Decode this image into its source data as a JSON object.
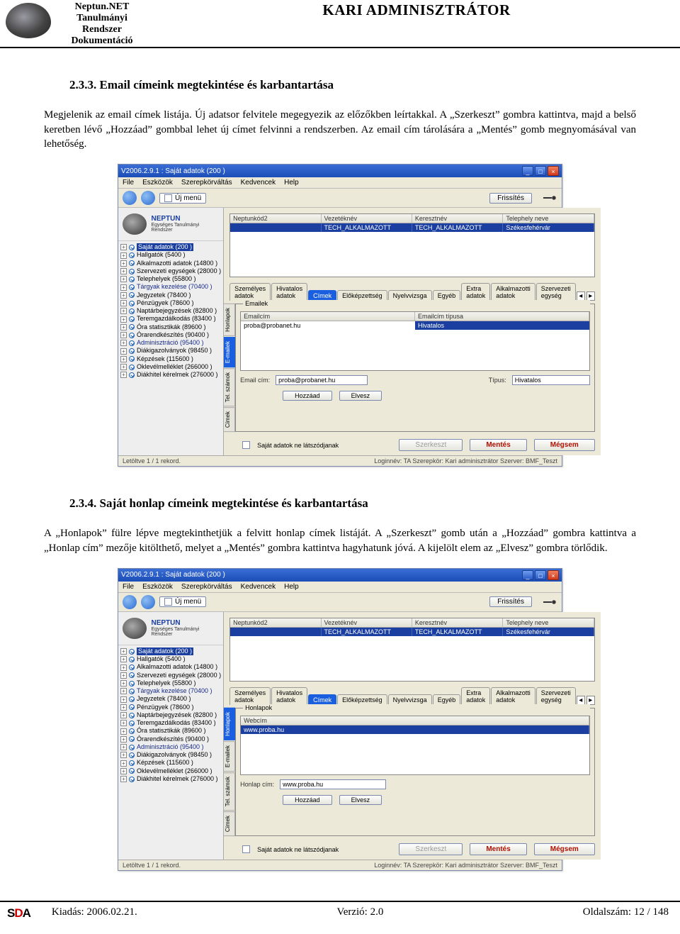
{
  "doc_header": {
    "line1": "Neptun.NET",
    "line2": "Tanulmányi",
    "line3": "Rendszer",
    "line4": "Dokumentáció",
    "role_title": "KARI ADMINISZTRÁTOR"
  },
  "section_233": {
    "heading": "2.3.3. Email címeink megtekintése és karbantartása",
    "para": "Megjelenik az email címek listája. Új adatsor felvitele megegyezik az előzőkben leírtakkal. A „Szerkeszt” gombra kattintva, majd a belső keretben lévő „Hozzáad” gombbal lehet új címet felvinni a rendszerben. Az email cím tárolására a „Mentés” gomb megnyomásával van lehetőség."
  },
  "section_234": {
    "heading": "2.3.4. Saját honlap címeink megtekintése és karbantartása",
    "para": "A „Honlapok” fülre lépve megtekinthetjük a felvitt honlap címek listáját. A „Szerkeszt” gomb után a „Hozzáad” gombra kattintva a „Honlap cím” mezője kitölthető, melyet a „Mentés” gombra kattintva hagyhatunk jóvá. A kijelölt elem az „Elvesz” gombra törlődik."
  },
  "app_common": {
    "title": "V2006.2.9.1 : Saját adatok (200  )",
    "menus": [
      "File",
      "Eszközök",
      "Szerepkörváltás",
      "Kedvencek",
      "Help"
    ],
    "newmenu": "Új menü",
    "refresh": "Frissítés",
    "brand": "NEPTUN",
    "brand_sub": "Egységes Tanulmányi Rendszer",
    "tree": [
      {
        "t": "Saját adatok (200  )",
        "sel": true,
        "top": true
      },
      {
        "t": "Hallgatók (5400  )"
      },
      {
        "t": "Alkalmazotti adatok (14800  )"
      },
      {
        "t": "Szervezeti egységek (28000  )"
      },
      {
        "t": "Telephelyek (55800  )"
      },
      {
        "t": "Tárgyak kezelése (70400  )",
        "blue": true
      },
      {
        "t": "Jegyzetek (78400  )"
      },
      {
        "t": "Pénzügyek (78600  )"
      },
      {
        "t": "Naptárbejegyzések (82800  )"
      },
      {
        "t": "Teremgazdálkodás (83400  )"
      },
      {
        "t": "Óra statisztikák (89600  )"
      },
      {
        "t": "Órarendkészítés (90400  )"
      },
      {
        "t": "Adminisztráció (95400  )",
        "blue": true
      },
      {
        "t": "Diákigazolványok (98450  )"
      },
      {
        "t": "Képzések (115600  )"
      },
      {
        "t": "Oklevélmelléklet (266000  )"
      },
      {
        "t": "Diákhitel kérelmek (276000  )"
      }
    ],
    "topgrid_headers": [
      "Neptunkód2",
      "Vezetéknév",
      "Keresztnév",
      "Telephely neve"
    ],
    "topgrid_row": [
      "",
      "TECH_ALKALMAZOTT",
      "TECH_ALKALMAZOTT",
      "Székesfehérvár"
    ],
    "tabs": [
      "Személyes adatok",
      "Hivatalos adatok",
      "Címek",
      "Előképzettség",
      "Nyelvvizsga",
      "Egyéb",
      "Extra adatok",
      "Alkalmazotti adatok",
      "Szervezeti egység"
    ],
    "checkbox_label": "Saját adatok ne látszódjanak",
    "btn_edit": "Szerkeszt",
    "btn_save": "Mentés",
    "btn_cancel": "Mégsem",
    "btn_add": "Hozzáad",
    "btn_remove": "Elvesz",
    "status_records": "Letöltve 1 / 1 rekord.",
    "status_login": "Loginnév: TA   Szerepkör: Kari adminisztrátor   Szerver: BMF_Teszt"
  },
  "app_email": {
    "vtabs": [
      "Honlapok",
      "E-mailek",
      "Tel. számok",
      "Címek"
    ],
    "active_vtab_index": 1,
    "legend": "Emailek",
    "grid_headers": [
      "Emailcím",
      "Emailcím típusa"
    ],
    "grid_row": [
      "proba@probanet.hu",
      "Hivatalos"
    ],
    "label_email": "Email cím:",
    "value_email": "proba@probanet.hu",
    "label_type": "Típus:",
    "value_type": "Hivatalos"
  },
  "app_web": {
    "vtabs": [
      "Honlapok",
      "E-mailek",
      "Tel. számok",
      "Címek"
    ],
    "active_vtab_index": 0,
    "legend": "Honlapok",
    "grid_headers": [
      "Webcím"
    ],
    "grid_row": [
      "www.proba.hu"
    ],
    "label_url": "Honlap cím:",
    "value_url": "www.proba.hu"
  },
  "footer": {
    "release": "Kiadás: 2006.02.21.",
    "version": "Verzió: 2.0",
    "page": "Oldalszám: 12 / 148"
  }
}
